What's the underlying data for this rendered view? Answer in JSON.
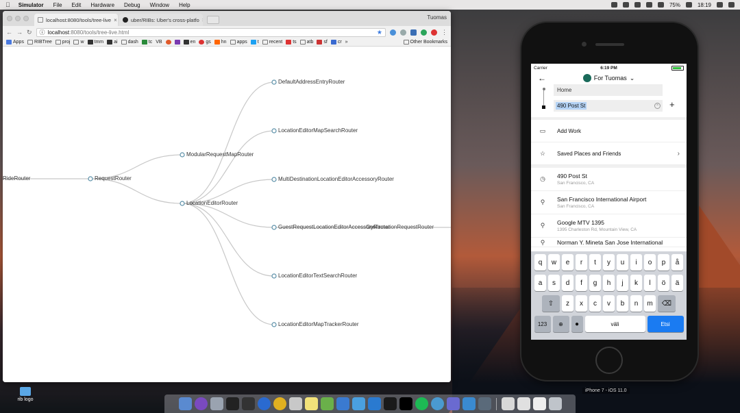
{
  "menubar": {
    "app_name": "Simulator",
    "items": [
      "File",
      "Edit",
      "Hardware",
      "Debug",
      "Window",
      "Help"
    ],
    "battery": "75%",
    "time": "18:19"
  },
  "browser": {
    "tabs": [
      {
        "label": "localhost:8080/tools/tree-live"
      },
      {
        "label": "uber/RIBs: Uber's cross-platfo"
      }
    ],
    "profile": "Tuomas",
    "url_host": "localhost",
    "url_path": ":8080/tools/tree-live.html",
    "bookmarks": [
      "Apps",
      "RIBTree",
      "proj",
      "w",
      "tmm",
      "ai",
      "dash",
      "tc",
      "VB",
      "en",
      "gs",
      "hn",
      "apps",
      "t",
      "recent",
      "ts",
      "atb",
      "sf",
      "cr"
    ],
    "other_bookmarks": "Other Bookmarks"
  },
  "tree": {
    "nodes": [
      "RideRouter",
      "RequestRouter",
      "ModularRequestMapRouter",
      "LocationEditorRouter",
      "DefaultAddressEntryRouter",
      "LocationEditorMapSearchRouter",
      "MultiDestinationLocationEditorAccessoryRouter",
      "GuestRequestLocationEditorAccessoryRouter",
      "ConfirmationRequestRouter",
      "LocationEditorTextSearchRouter",
      "LocationEditorMapTrackerRouter"
    ]
  },
  "phone": {
    "carrier": "Carrier",
    "time": "6:19 PM",
    "rider_label": "For Tuomas",
    "pickup_value": "Home",
    "destination_value": "490 Post St",
    "add_work": "Add Work",
    "saved_places": "Saved Places and Friends",
    "places": [
      {
        "title": "490 Post St",
        "subtitle": "San Francisco, CA",
        "icon": "clock-icon"
      },
      {
        "title": "San Francisco International Airport",
        "subtitle": "San Francisco, CA",
        "icon": "pin-icon"
      },
      {
        "title": "Google MTV 1395",
        "subtitle": "1395 Charleston Rd, Mountain View, CA",
        "icon": "pin-icon"
      },
      {
        "title": "Norman Y. Mineta San Jose International",
        "subtitle": "",
        "icon": "pin-icon"
      }
    ],
    "keyboard": {
      "row1": [
        "q",
        "w",
        "e",
        "r",
        "t",
        "y",
        "u",
        "i",
        "o",
        "p",
        "å"
      ],
      "row2": [
        "a",
        "s",
        "d",
        "f",
        "g",
        "h",
        "j",
        "k",
        "l",
        "ö",
        "ä"
      ],
      "row3": [
        "z",
        "x",
        "c",
        "v",
        "b",
        "n",
        "m"
      ],
      "numbers_key": "123",
      "space_key": "väli",
      "go_key": "Etsi"
    },
    "device_label": "iPhone 7 - iOS 11.0"
  },
  "desktop": {
    "icon_label": "rib logo"
  },
  "colors": {
    "accent_blue": "#1a7bf2",
    "tree_link": "#c8c8c8",
    "tree_node": "#5a8fa8"
  }
}
